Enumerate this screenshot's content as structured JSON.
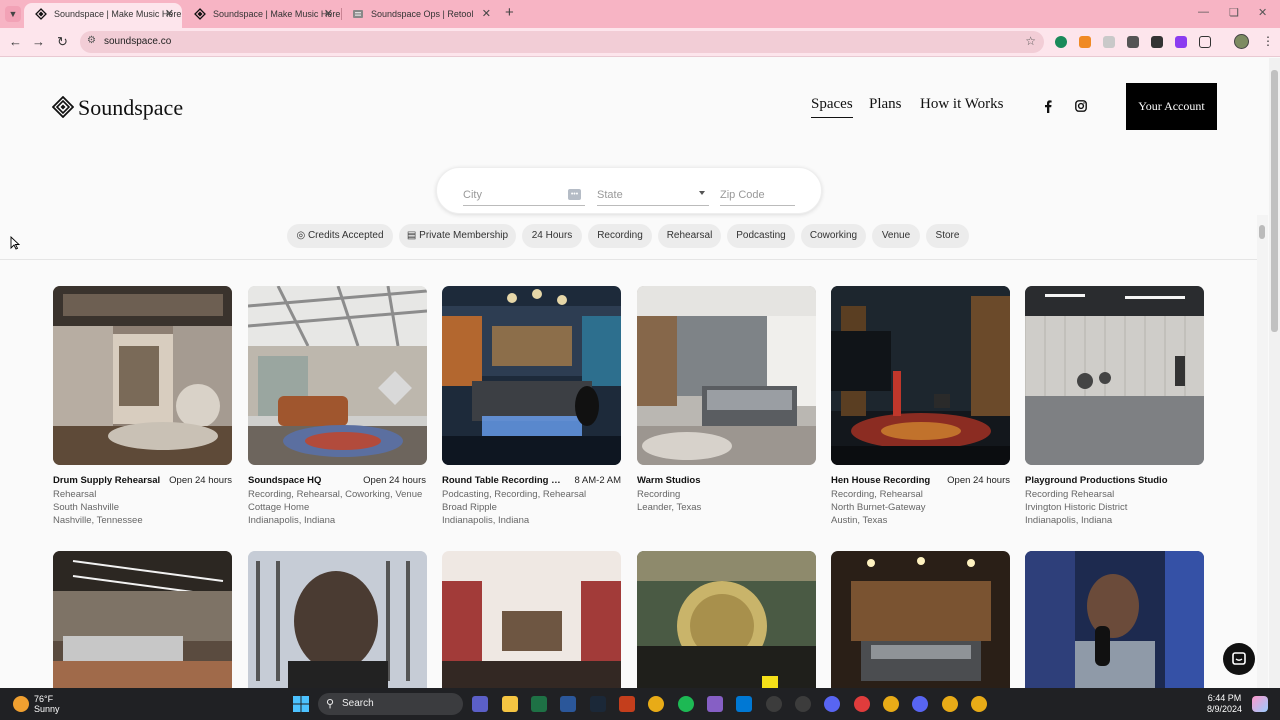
{
  "browser": {
    "tabs": [
      {
        "title": "Soundspace | Make Music Here",
        "active": true
      },
      {
        "title": "Soundspace | Make Music Here",
        "active": false
      },
      {
        "title": "Soundspace Ops | Retool",
        "active": false
      }
    ],
    "url": "soundspace.co"
  },
  "site": {
    "logo_text": "Soundspace",
    "nav": [
      {
        "label": "Spaces",
        "active": true
      },
      {
        "label": "Plans",
        "active": false
      },
      {
        "label": "How it Works",
        "active": false
      }
    ],
    "account_button": "Your Account"
  },
  "search": {
    "city_placeholder": "City",
    "state_placeholder": "State",
    "zip_placeholder": "Zip Code"
  },
  "filters": [
    "Credits Accepted",
    "Private Membership",
    "24 Hours",
    "Recording",
    "Rehearsal",
    "Podcasting",
    "Coworking",
    "Venue",
    "Store"
  ],
  "listings": [
    {
      "name": "Drum Supply Rehearsal",
      "hours": "Open 24 hours",
      "types": "Rehearsal",
      "neighborhood": "South Nashville",
      "city": "Nashville, Tennessee"
    },
    {
      "name": "Soundspace HQ",
      "hours": "Open 24 hours",
      "types": "Recording, Rehearsal, Coworking, Venue",
      "neighborhood": "Cottage Home",
      "city": "Indianapolis, Indiana"
    },
    {
      "name": "Round Table Recording Co...",
      "hours": "8 AM-2 AM",
      "types": "Podcasting, Recording, Rehearsal",
      "neighborhood": "Broad Ripple",
      "city": "Indianapolis, Indiana"
    },
    {
      "name": "Warm Studios",
      "hours": "",
      "types": "Recording",
      "neighborhood": "Leander, Texas",
      "city": ""
    },
    {
      "name": "Hen House Recording",
      "hours": "Open 24 hours",
      "types": "Recording, Rehearsal",
      "neighborhood": "North Burnet-Gateway",
      "city": "Austin, Texas"
    },
    {
      "name": "Playground Productions Studio",
      "hours": "",
      "types": "Recording Rehearsal",
      "neighborhood": "Irvington Historic District",
      "city": "Indianapolis, Indiana"
    }
  ],
  "taskbar": {
    "temperature": "76°F",
    "condition": "Sunny",
    "search_label": "Search",
    "time": "6:44 PM",
    "date": "8/9/2024"
  }
}
